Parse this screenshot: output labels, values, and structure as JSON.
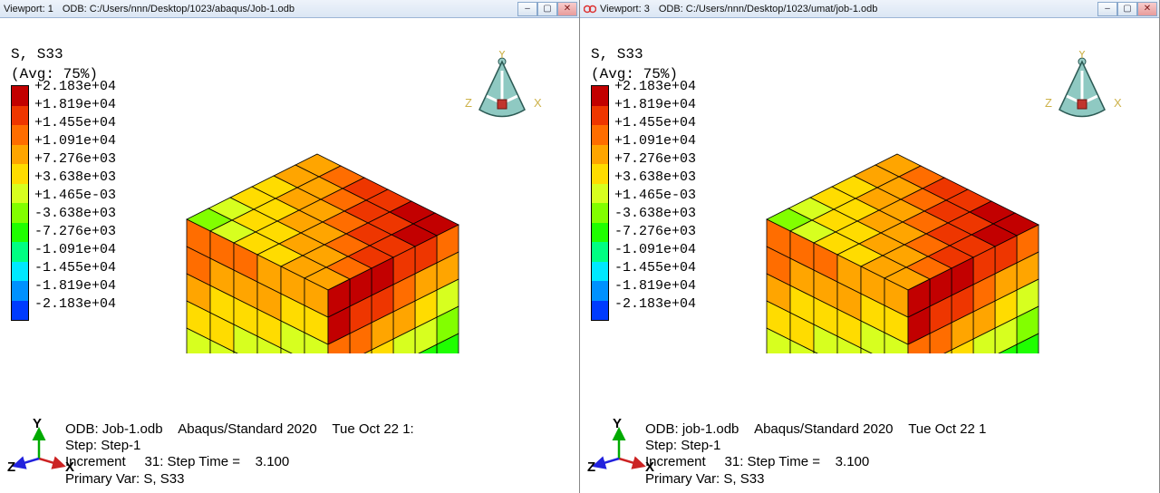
{
  "viewports": [
    {
      "vp_label": "Viewport: 1",
      "odb_label": "ODB: C:/Users/nnn/Desktop/1023/abaqus/Job-1.odb",
      "sync": false,
      "info": {
        "odb": "ODB: Job-1.odb",
        "solver": "Abaqus/Standard 2020",
        "date": "Tue Oct 22 1:",
        "step": "Step: Step-1",
        "incr": "Increment     31: Step Time =    3.100",
        "primary": "Primary Var: S, S33"
      }
    },
    {
      "vp_label": "Viewport: 3",
      "odb_label": "ODB: C:/Users/nnn/Desktop/1023/umat/job-1.odb",
      "sync": true,
      "info": {
        "odb": "ODB: job-1.odb",
        "solver": "Abaqus/Standard 2020",
        "date": "Tue Oct 22 1",
        "step": "Step: Step-1",
        "incr": "Increment     31: Step Time =    3.100",
        "primary": "Primary Var: S, S33"
      }
    }
  ],
  "legend": {
    "title1": "S, S33",
    "title2": "(Avg: 75%)",
    "values": [
      "+2.183e+04",
      "+1.819e+04",
      "+1.455e+04",
      "+1.091e+04",
      "+7.276e+03",
      "+3.638e+03",
      "+1.465e-03",
      "-3.638e+03",
      "-7.276e+03",
      "-1.091e+04",
      "-1.455e+04",
      "-1.819e+04",
      "-2.183e+04"
    ],
    "colors": [
      "#c20000",
      "#ee3600",
      "#ff6d00",
      "#ffa500",
      "#ffdc00",
      "#d7ff1f",
      "#82ff00",
      "#1fff00",
      "#00ff82",
      "#00e8ff",
      "#0091ff",
      "#003bff"
    ]
  },
  "axes": {
    "x": "X",
    "y": "Y",
    "z": "Z"
  },
  "compass": {
    "x": "X",
    "y": "Y",
    "z": "Z"
  },
  "win_btn": {
    "min": "–",
    "max": "▢",
    "close": "✕"
  }
}
